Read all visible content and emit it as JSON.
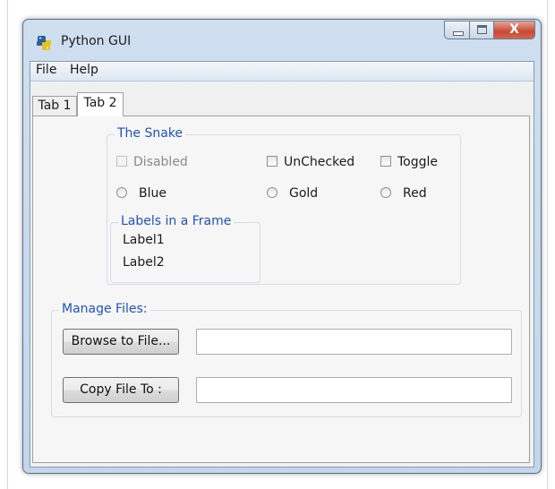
{
  "window": {
    "title": "Python GUI",
    "close_glyph": "X"
  },
  "menu": {
    "items": [
      "File",
      "Help"
    ]
  },
  "tabs": [
    {
      "label": "Tab 1"
    },
    {
      "label": "Tab 2"
    }
  ],
  "snake_frame": {
    "legend": "The Snake",
    "checkboxes": [
      {
        "label": "Disabled",
        "checked": false,
        "enabled": false
      },
      {
        "label": "UnChecked",
        "checked": false,
        "enabled": true
      },
      {
        "label": "Toggle",
        "checked": false,
        "enabled": true
      }
    ],
    "radios": [
      {
        "label": "Blue",
        "selected": false
      },
      {
        "label": "Gold",
        "selected": false
      },
      {
        "label": "Red",
        "selected": false
      }
    ],
    "labels_frame": {
      "legend": "Labels in a Frame",
      "labels": [
        "Label1",
        "Label2"
      ]
    }
  },
  "manage_files": {
    "legend": "Manage Files:",
    "browse_button": "Browse to File...",
    "browse_value": "",
    "copy_button": "Copy File To :",
    "copy_value": ""
  },
  "colors": {
    "legend_blue": "#1e52c8",
    "title_bar": "#c3d6ec",
    "close_red": "#c94a33"
  }
}
